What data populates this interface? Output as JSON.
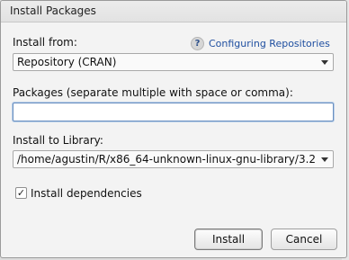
{
  "dialog": {
    "title": "Install Packages",
    "install_from": {
      "label": "Install from:",
      "value": "Repository (CRAN)"
    },
    "help": {
      "icon_text": "?",
      "link_label": "Configuring Repositories"
    },
    "packages": {
      "label": "Packages (separate multiple with space or comma):",
      "value": "",
      "placeholder": ""
    },
    "library": {
      "label": "Install to Library:",
      "value": "/home/agustin/R/x86_64-unknown-linux-gnu-library/3.2"
    },
    "dependencies": {
      "label": "Install dependencies",
      "checked": true,
      "check_glyph": "✓"
    },
    "buttons": {
      "install": "Install",
      "cancel": "Cancel"
    }
  }
}
